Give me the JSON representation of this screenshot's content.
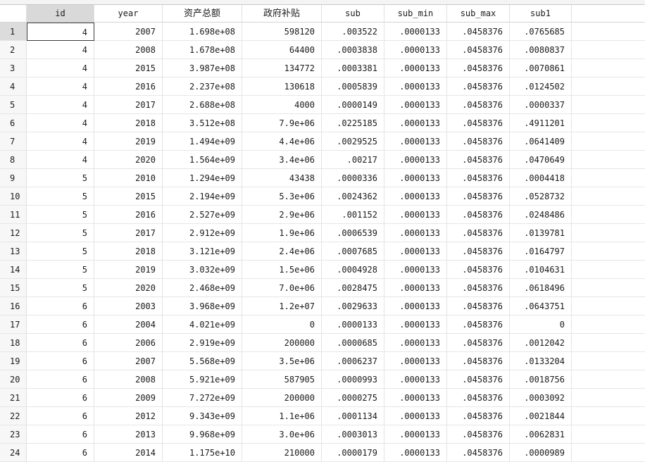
{
  "columns": [
    "id",
    "year",
    "资产总额",
    "政府补贴",
    "sub",
    "sub_min",
    "sub_max",
    "sub1"
  ],
  "rows": [
    {
      "n": "1",
      "v": [
        "4",
        "2007",
        "1.698e+08",
        "598120",
        ".003522",
        ".0000133",
        ".0458376",
        ".0765685"
      ]
    },
    {
      "n": "2",
      "v": [
        "4",
        "2008",
        "1.678e+08",
        "64400",
        ".0003838",
        ".0000133",
        ".0458376",
        ".0080837"
      ]
    },
    {
      "n": "3",
      "v": [
        "4",
        "2015",
        "3.987e+08",
        "134772",
        ".0003381",
        ".0000133",
        ".0458376",
        ".0070861"
      ]
    },
    {
      "n": "4",
      "v": [
        "4",
        "2016",
        "2.237e+08",
        "130618",
        ".0005839",
        ".0000133",
        ".0458376",
        ".0124502"
      ]
    },
    {
      "n": "5",
      "v": [
        "4",
        "2017",
        "2.688e+08",
        "4000",
        ".0000149",
        ".0000133",
        ".0458376",
        ".0000337"
      ]
    },
    {
      "n": "6",
      "v": [
        "4",
        "2018",
        "3.512e+08",
        "7.9e+06",
        ".0225185",
        ".0000133",
        ".0458376",
        ".4911201"
      ]
    },
    {
      "n": "7",
      "v": [
        "4",
        "2019",
        "1.494e+09",
        "4.4e+06",
        ".0029525",
        ".0000133",
        ".0458376",
        ".0641409"
      ]
    },
    {
      "n": "8",
      "v": [
        "4",
        "2020",
        "1.564e+09",
        "3.4e+06",
        ".00217",
        ".0000133",
        ".0458376",
        ".0470649"
      ]
    },
    {
      "n": "9",
      "v": [
        "5",
        "2010",
        "1.294e+09",
        "43438",
        ".0000336",
        ".0000133",
        ".0458376",
        ".0004418"
      ]
    },
    {
      "n": "10",
      "v": [
        "5",
        "2015",
        "2.194e+09",
        "5.3e+06",
        ".0024362",
        ".0000133",
        ".0458376",
        ".0528732"
      ]
    },
    {
      "n": "11",
      "v": [
        "5",
        "2016",
        "2.527e+09",
        "2.9e+06",
        ".001152",
        ".0000133",
        ".0458376",
        ".0248486"
      ]
    },
    {
      "n": "12",
      "v": [
        "5",
        "2017",
        "2.912e+09",
        "1.9e+06",
        ".0006539",
        ".0000133",
        ".0458376",
        ".0139781"
      ]
    },
    {
      "n": "13",
      "v": [
        "5",
        "2018",
        "3.121e+09",
        "2.4e+06",
        ".0007685",
        ".0000133",
        ".0458376",
        ".0164797"
      ]
    },
    {
      "n": "14",
      "v": [
        "5",
        "2019",
        "3.032e+09",
        "1.5e+06",
        ".0004928",
        ".0000133",
        ".0458376",
        ".0104631"
      ]
    },
    {
      "n": "15",
      "v": [
        "5",
        "2020",
        "2.468e+09",
        "7.0e+06",
        ".0028475",
        ".0000133",
        ".0458376",
        ".0618496"
      ]
    },
    {
      "n": "16",
      "v": [
        "6",
        "2003",
        "3.968e+09",
        "1.2e+07",
        ".0029633",
        ".0000133",
        ".0458376",
        ".0643751"
      ]
    },
    {
      "n": "17",
      "v": [
        "6",
        "2004",
        "4.021e+09",
        "0",
        ".0000133",
        ".0000133",
        ".0458376",
        "0"
      ]
    },
    {
      "n": "18",
      "v": [
        "6",
        "2006",
        "2.919e+09",
        "200000",
        ".0000685",
        ".0000133",
        ".0458376",
        ".0012042"
      ]
    },
    {
      "n": "19",
      "v": [
        "6",
        "2007",
        "5.568e+09",
        "3.5e+06",
        ".0006237",
        ".0000133",
        ".0458376",
        ".0133204"
      ]
    },
    {
      "n": "20",
      "v": [
        "6",
        "2008",
        "5.921e+09",
        "587905",
        ".0000993",
        ".0000133",
        ".0458376",
        ".0018756"
      ]
    },
    {
      "n": "21",
      "v": [
        "6",
        "2009",
        "7.272e+09",
        "200000",
        ".0000275",
        ".0000133",
        ".0458376",
        ".0003092"
      ]
    },
    {
      "n": "22",
      "v": [
        "6",
        "2012",
        "9.343e+09",
        "1.1e+06",
        ".0001134",
        ".0000133",
        ".0458376",
        ".0021844"
      ]
    },
    {
      "n": "23",
      "v": [
        "6",
        "2013",
        "9.968e+09",
        "3.0e+06",
        ".0003013",
        ".0000133",
        ".0458376",
        ".0062831"
      ]
    },
    {
      "n": "24",
      "v": [
        "6",
        "2014",
        "1.175e+10",
        "210000",
        ".0000179",
        ".0000133",
        ".0458376",
        ".0000989"
      ]
    }
  ]
}
